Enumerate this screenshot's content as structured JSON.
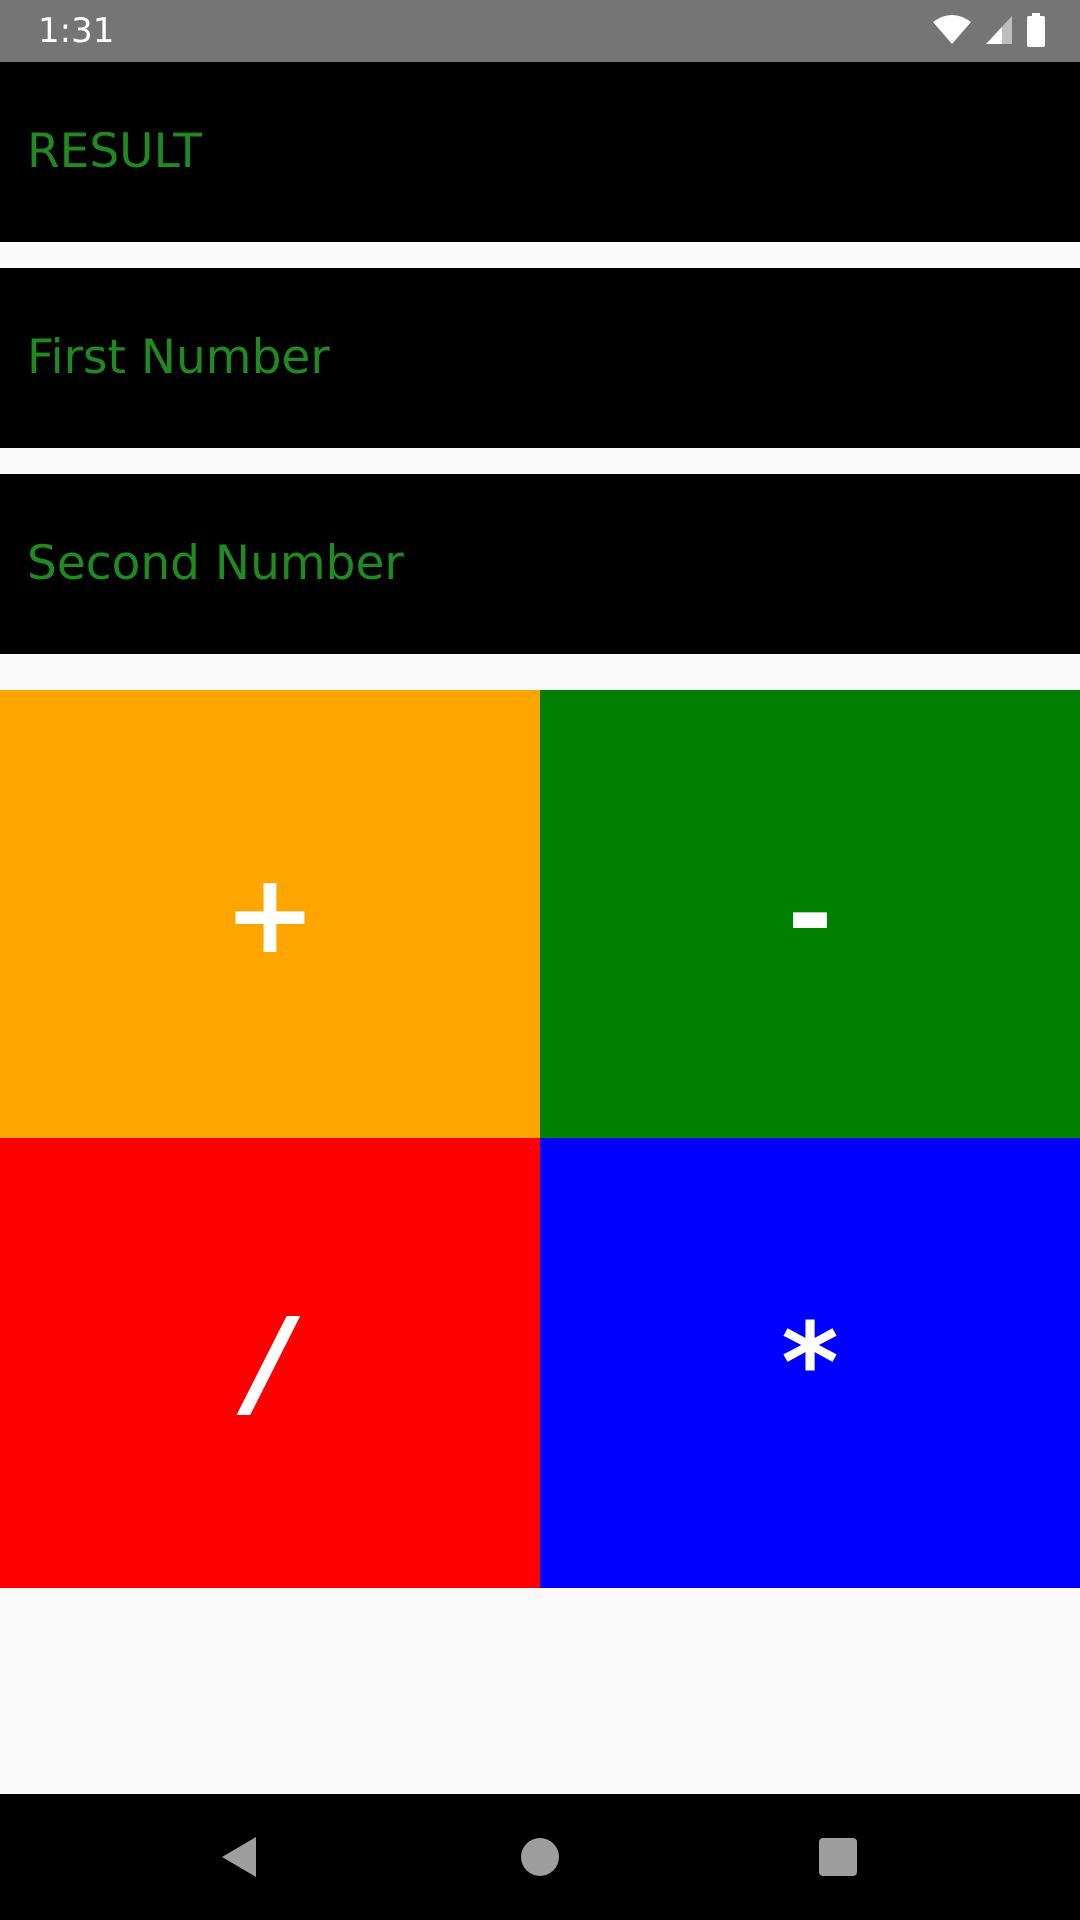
{
  "status_bar": {
    "time": "1:31",
    "icons": [
      "wifi-icon",
      "cellular-signal-icon",
      "battery-icon"
    ]
  },
  "fields": {
    "result": {
      "text": "RESULT"
    },
    "first_number": {
      "placeholder": "First Number"
    },
    "second_number": {
      "placeholder": "Second Number"
    }
  },
  "buttons": {
    "add": {
      "label": "+"
    },
    "subtract": {
      "label": "-"
    },
    "divide": {
      "label": "/"
    },
    "multiply": {
      "label": "*"
    }
  },
  "nav_bar": {
    "icons": [
      "back-icon",
      "home-icon",
      "recents-icon"
    ]
  },
  "colors": {
    "status_bar_bg": "#757575",
    "field_bg": "#000000",
    "field_text": "#1f8a1f",
    "add_bg": "#ffa500",
    "subtract_bg": "#008000",
    "divide_bg": "#ff0000",
    "multiply_bg": "#0000ff",
    "button_text": "#ffffff",
    "nav_bar_bg": "#000000",
    "nav_icon": "#9e9e9e"
  }
}
